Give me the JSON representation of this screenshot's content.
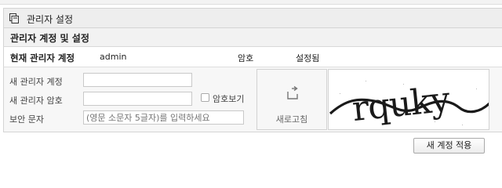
{
  "panel": {
    "title": "관리자 설정",
    "icon": "copy-window-icon"
  },
  "section": {
    "title": "관리자 계정 및 설정"
  },
  "current": {
    "label": "현재 관리자 계정",
    "value": "admin",
    "password_label": "암호",
    "password_status": "설정됨"
  },
  "form": {
    "new_account_label": "새 관리자 계정",
    "new_account_value": "",
    "new_password_label": "새 관리자 암호",
    "new_password_value": "",
    "show_password_label": "암호보기",
    "show_password_checked": false,
    "security_label": "보안 문자",
    "security_placeholder": "(영문 소문자 5글자)를 입력하세요",
    "refresh_label": "새로고침",
    "refresh_icon": "refresh-icon",
    "captcha_text": "rquky"
  },
  "submit_label": "새 계정 적용"
}
